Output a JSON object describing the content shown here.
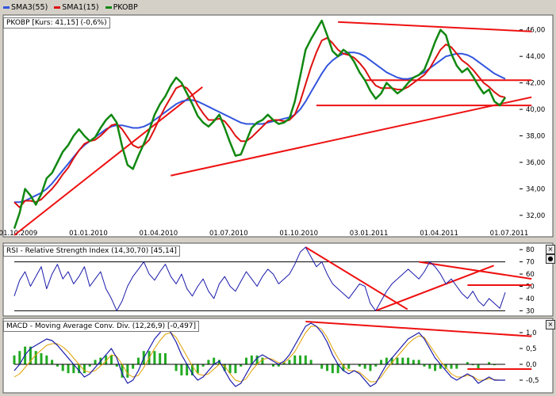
{
  "legend": {
    "items": [
      {
        "label": "SMA3(55)",
        "color": "#3355dd"
      },
      {
        "label": "SMA1(15)",
        "color": "#dd1111"
      },
      {
        "label": "PKOBP",
        "color": "#118811"
      }
    ]
  },
  "panels": {
    "price_caption": "PKOBP [Kurs: 41,15] (-0,6%)",
    "rsi_caption": "RSI - Relative Strength Index (14,30,70) [45,14]",
    "macd_caption": "MACD - Moving Average Conv. Div. (12,26,9) [-0,497]",
    "close_icon_glyph": "×",
    "restore_icon_glyph": "●"
  },
  "chart_data": [
    {
      "type": "line",
      "name": "price",
      "x_labels": [
        "01.10.2009",
        "01.01.2010",
        "01.04.2010",
        "01.07.2010",
        "01.10.2010",
        "03.01.2011",
        "01.04.2011",
        "01.07.2011"
      ],
      "y_ticks": [
        "32,00",
        "34,00",
        "36,00",
        "38,00",
        "40,00",
        "42,00",
        "44,00",
        "46,00"
      ],
      "ylim": [
        30.5,
        47.0
      ],
      "series": [
        {
          "name": "PKOBP",
          "color": "#118811",
          "values": [
            31.0,
            32.2,
            34.0,
            33.5,
            32.8,
            33.6,
            34.8,
            35.2,
            36.0,
            36.8,
            37.3,
            38.0,
            38.5,
            38.0,
            37.6,
            37.9,
            38.6,
            39.2,
            39.6,
            39.0,
            37.2,
            35.8,
            35.5,
            36.5,
            37.4,
            38.4,
            39.6,
            40.4,
            41.0,
            41.8,
            42.4,
            42.0,
            41.2,
            40.4,
            39.5,
            39.0,
            38.7,
            39.1,
            39.6,
            38.6,
            37.5,
            36.5,
            36.6,
            37.6,
            38.6,
            39.0,
            39.2,
            39.6,
            39.2,
            38.9,
            39.0,
            39.3,
            40.6,
            42.5,
            44.5,
            45.3,
            46.0,
            46.7,
            45.6,
            44.4,
            44.0,
            44.5,
            44.2,
            43.6,
            42.8,
            42.2,
            41.4,
            40.8,
            41.2,
            42.0,
            41.6,
            41.2,
            41.5,
            42.0,
            42.4,
            42.6,
            43.0,
            44.0,
            45.1,
            46.0,
            45.6,
            44.2,
            43.3,
            42.8,
            43.1,
            42.5,
            41.8,
            41.2,
            41.5,
            40.6,
            40.3,
            40.9
          ]
        },
        {
          "name": "SMA1(15)",
          "color": "#dd1111",
          "values": [
            33.0,
            32.6,
            33.1,
            33.1,
            33.0,
            33.2,
            33.6,
            34.0,
            34.5,
            35.1,
            35.6,
            36.3,
            36.9,
            37.4,
            37.6,
            37.7,
            38.0,
            38.4,
            38.8,
            38.9,
            38.5,
            37.9,
            37.3,
            37.1,
            37.3,
            37.7,
            38.5,
            39.4,
            40.2,
            40.9,
            41.6,
            41.8,
            41.6,
            41.1,
            40.3,
            39.7,
            39.2,
            39.2,
            39.3,
            39.1,
            38.6,
            38.0,
            37.6,
            37.6,
            37.9,
            38.3,
            38.7,
            39.1,
            39.2,
            39.2,
            39.1,
            39.2,
            39.6,
            40.6,
            41.9,
            43.2,
            44.3,
            45.2,
            45.4,
            45.0,
            44.5,
            44.2,
            44.1,
            43.9,
            43.5,
            43.0,
            42.3,
            41.8,
            41.6,
            41.6,
            41.6,
            41.5,
            41.5,
            41.7,
            42.0,
            42.3,
            42.6,
            43.1,
            43.8,
            44.5,
            44.9,
            44.7,
            44.2,
            43.7,
            43.4,
            43.0,
            42.5,
            42.0,
            41.7,
            41.3,
            41.0,
            40.9
          ]
        },
        {
          "name": "SMA3(55)",
          "color": "#3355dd",
          "values": [
            33.0,
            33.0,
            33.1,
            33.3,
            33.5,
            33.7,
            34.0,
            34.4,
            34.9,
            35.4,
            35.9,
            36.4,
            36.9,
            37.3,
            37.6,
            37.9,
            38.2,
            38.5,
            38.7,
            38.8,
            38.8,
            38.7,
            38.6,
            38.6,
            38.7,
            38.9,
            39.2,
            39.5,
            39.8,
            40.1,
            40.4,
            40.6,
            40.7,
            40.7,
            40.6,
            40.4,
            40.2,
            40.0,
            39.8,
            39.6,
            39.4,
            39.2,
            39.0,
            38.9,
            38.9,
            38.9,
            38.9,
            39.0,
            39.1,
            39.2,
            39.3,
            39.4,
            39.6,
            40.0,
            40.6,
            41.3,
            42.0,
            42.7,
            43.3,
            43.7,
            44.0,
            44.2,
            44.3,
            44.3,
            44.2,
            44.0,
            43.7,
            43.4,
            43.1,
            42.8,
            42.6,
            42.4,
            42.3,
            42.3,
            42.4,
            42.6,
            42.8,
            43.1,
            43.4,
            43.7,
            44.0,
            44.1,
            44.2,
            44.2,
            44.1,
            43.9,
            43.6,
            43.3,
            43.0,
            42.7,
            42.5,
            42.3
          ]
        }
      ],
      "trendlines": [
        {
          "from": [
            0,
            30.5
          ],
          "to": [
            29,
            39.8
          ]
        },
        {
          "from": [
            29,
            35.0
          ],
          "to": [
            90,
            40.4
          ]
        },
        {
          "from": [
            60,
            46.6
          ],
          "to": [
            90,
            46.0
          ]
        },
        {
          "from": [
            65,
            42.2
          ],
          "to": [
            90,
            42.2
          ]
        },
        {
          "from": [
            56,
            40.3
          ],
          "to": [
            90,
            40.3
          ]
        }
      ]
    },
    {
      "type": "line",
      "name": "rsi",
      "y_ticks": [
        "30",
        "40",
        "50",
        "60",
        "70",
        "80"
      ],
      "ylim": [
        27,
        84
      ],
      "reference_lines": [
        30,
        70
      ],
      "series": [
        {
          "name": "RSI",
          "color": "#1a1aaa",
          "values": [
            42,
            55,
            62,
            50,
            58,
            66,
            48,
            60,
            68,
            56,
            62,
            52,
            58,
            66,
            50,
            56,
            62,
            48,
            40,
            30,
            38,
            50,
            58,
            64,
            70,
            60,
            55,
            62,
            68,
            58,
            52,
            60,
            48,
            42,
            50,
            56,
            46,
            40,
            52,
            58,
            50,
            46,
            54,
            62,
            56,
            50,
            58,
            64,
            60,
            52,
            56,
            60,
            68,
            78,
            82,
            74,
            66,
            70,
            60,
            52,
            48,
            44,
            40,
            46,
            52,
            50,
            36,
            30,
            38,
            46,
            52,
            56,
            60,
            64,
            60,
            56,
            62,
            70,
            66,
            60,
            52,
            56,
            50,
            44,
            40,
            46,
            38,
            34,
            40,
            36,
            32,
            45
          ]
        }
      ],
      "trendlines": [
        {
          "from": [
            54,
            82
          ],
          "to": [
            67,
            47
          ]
        },
        {
          "from": [
            67,
            30
          ],
          "to": [
            83,
            57
          ]
        },
        {
          "from": [
            75,
            70
          ],
          "to": [
            90,
            60
          ]
        },
        {
          "from": [
            84,
            51
          ],
          "to": [
            90,
            51
          ]
        }
      ]
    },
    {
      "type": "line",
      "name": "macd",
      "y_ticks": [
        "-0,5",
        "0,0",
        "0,5",
        "1,0"
      ],
      "ylim": [
        -0.85,
        1.4
      ],
      "series": [
        {
          "name": "MACD",
          "color": "#1a1aaa",
          "values": [
            -0.2,
            0.0,
            0.3,
            0.5,
            0.6,
            0.7,
            0.8,
            0.75,
            0.6,
            0.4,
            0.2,
            0.0,
            -0.2,
            -0.4,
            -0.3,
            -0.1,
            0.1,
            0.3,
            0.5,
            0.2,
            -0.3,
            -0.6,
            -0.5,
            -0.2,
            0.2,
            0.5,
            0.8,
            1.0,
            1.2,
            1.0,
            0.7,
            0.3,
            0.0,
            -0.3,
            -0.5,
            -0.4,
            -0.2,
            0.0,
            0.1,
            -0.2,
            -0.5,
            -0.7,
            -0.6,
            -0.3,
            0.0,
            0.2,
            0.3,
            0.2,
            0.1,
            0.0,
            0.1,
            0.3,
            0.6,
            0.9,
            1.2,
            1.3,
            1.2,
            1.0,
            0.7,
            0.3,
            0.0,
            -0.2,
            -0.3,
            -0.2,
            -0.3,
            -0.5,
            -0.7,
            -0.6,
            -0.3,
            0.0,
            0.2,
            0.4,
            0.6,
            0.8,
            0.9,
            1.0,
            0.8,
            0.5,
            0.2,
            0.0,
            -0.2,
            -0.4,
            -0.5,
            -0.4,
            -0.3,
            -0.4,
            -0.6,
            -0.5,
            -0.4,
            -0.5,
            -0.5,
            -0.5
          ]
        },
        {
          "name": "Signal",
          "color": "#e0a000",
          "values": [
            -0.4,
            -0.3,
            -0.1,
            0.1,
            0.3,
            0.45,
            0.6,
            0.65,
            0.65,
            0.55,
            0.4,
            0.2,
            0.0,
            -0.2,
            -0.25,
            -0.2,
            -0.05,
            0.1,
            0.3,
            0.25,
            0.0,
            -0.3,
            -0.4,
            -0.35,
            -0.1,
            0.2,
            0.5,
            0.75,
            0.95,
            1.0,
            0.85,
            0.55,
            0.25,
            -0.05,
            -0.3,
            -0.35,
            -0.3,
            -0.15,
            0.0,
            -0.05,
            -0.3,
            -0.5,
            -0.55,
            -0.45,
            -0.2,
            0.0,
            0.15,
            0.2,
            0.15,
            0.05,
            0.05,
            0.2,
            0.4,
            0.7,
            1.0,
            1.2,
            1.2,
            1.1,
            0.85,
            0.5,
            0.2,
            -0.05,
            -0.2,
            -0.2,
            -0.25,
            -0.4,
            -0.55,
            -0.55,
            -0.4,
            -0.15,
            0.05,
            0.25,
            0.45,
            0.65,
            0.8,
            0.9,
            0.85,
            0.6,
            0.35,
            0.1,
            -0.1,
            -0.3,
            -0.4,
            -0.4,
            -0.35,
            -0.38,
            -0.5,
            -0.5,
            -0.45,
            -0.48,
            -0.5,
            -0.5
          ]
        }
      ],
      "trendlines": [
        {
          "from": [
            54,
            1.35
          ],
          "to": [
            90,
            0.95
          ]
        },
        {
          "from": [
            84,
            -0.15
          ],
          "to": [
            90,
            -0.15
          ]
        }
      ]
    }
  ]
}
